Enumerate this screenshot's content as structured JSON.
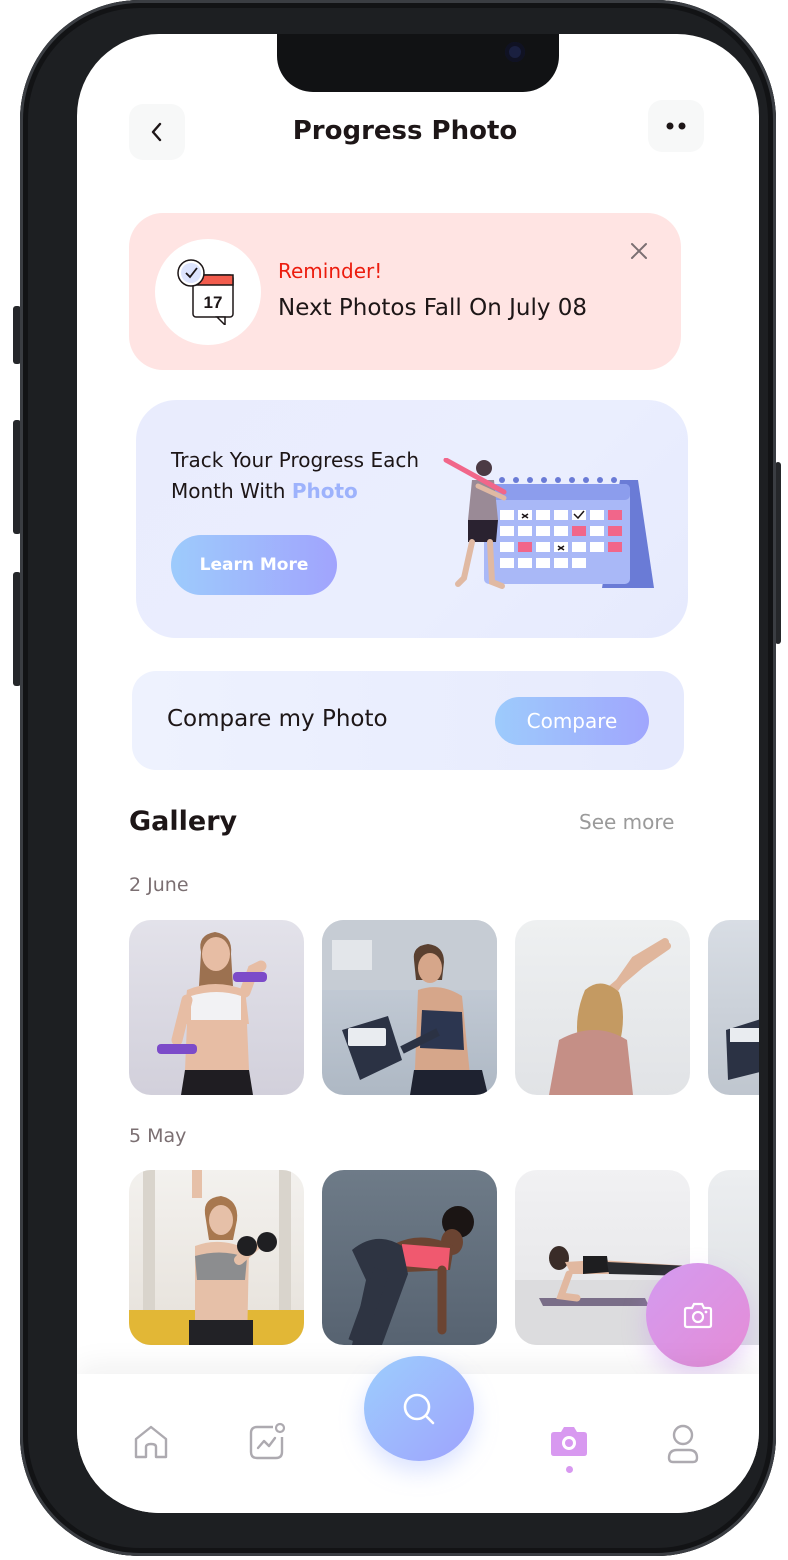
{
  "header": {
    "title": "Progress Photo"
  },
  "reminder": {
    "label": "Reminder!",
    "text": "Next Photos Fall On July 08",
    "calendar_day": "17"
  },
  "track": {
    "line1": "Track Your Progress Each",
    "line2_prefix": "Month With ",
    "line2_accent": "Photo",
    "button": "Learn More"
  },
  "compare": {
    "text": "Compare my Photo",
    "button": "Compare"
  },
  "gallery": {
    "title": "Gallery",
    "see_more": "See more",
    "groups": [
      {
        "date": "2 June",
        "photos": [
          "woman-with-dumbbells",
          "woman-on-exercise-bike",
          "woman-stretching",
          "partial-photo"
        ]
      },
      {
        "date": "5 May",
        "photos": [
          "woman-lifting-dumbbell",
          "woman-bending-stretch",
          "woman-plank",
          "partial-photo"
        ]
      }
    ]
  },
  "nav": {
    "items": [
      "home-icon",
      "activity-icon",
      "search-icon",
      "camera-icon",
      "profile-icon"
    ],
    "active": "camera-icon"
  },
  "colors": {
    "accent": "#9db2fc",
    "reminder_red": "#ec1c0e",
    "active_pink": "#d899f0",
    "text": "#1d1617"
  }
}
